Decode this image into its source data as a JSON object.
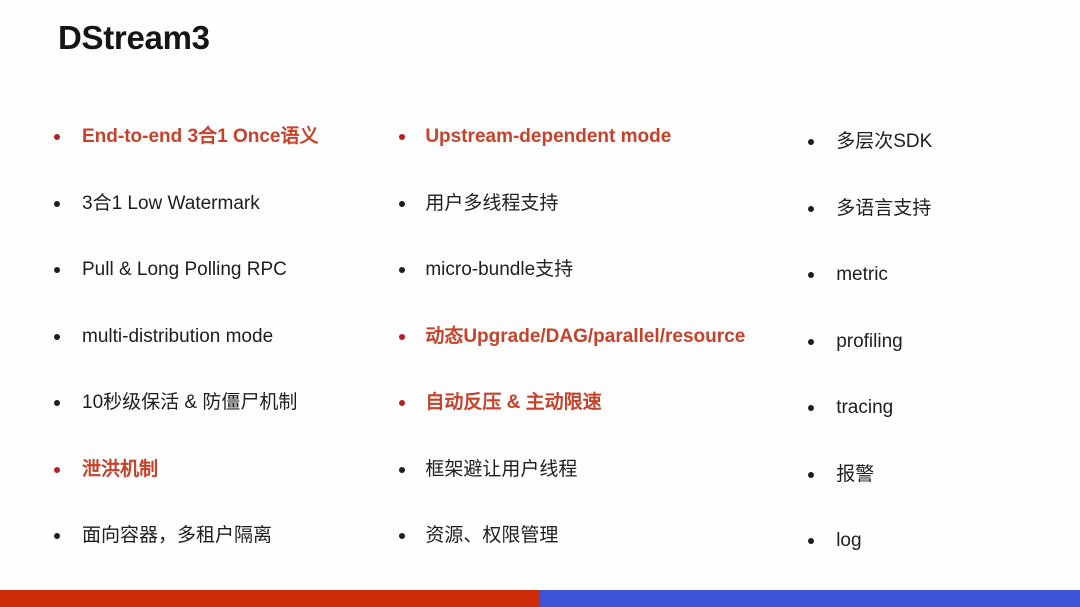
{
  "slide": {
    "title": "DStream3",
    "background_color": "#FEFEFE",
    "accent_color": "#C8412A",
    "text_color": "#1E1E1E",
    "bullet_color": "#1E1E1E",
    "accent_bullet_color": "#B62020"
  },
  "columns": [
    {
      "id": "column-1",
      "items": [
        {
          "label": "End-to-end 3合1 Once语义",
          "accent": true
        },
        {
          "label": "3合1 Low Watermark",
          "accent": false
        },
        {
          "label": "Pull & Long Polling RPC",
          "accent": false
        },
        {
          "label": "multi-distribution mode",
          "accent": false
        },
        {
          "label": "10秒级保活 & 防僵尸机制",
          "accent": false
        },
        {
          "label": "泄洪机制",
          "accent": true
        },
        {
          "label": "面向容器，多租户隔离",
          "accent": false
        }
      ]
    },
    {
      "id": "column-2",
      "items": [
        {
          "label": "Upstream-dependent mode",
          "accent": true
        },
        {
          "label": "用户多线程支持",
          "accent": false
        },
        {
          "label": "micro-bundle支持",
          "accent": false
        },
        {
          "label": "动态Upgrade/DAG/parallel/resource",
          "accent": true
        },
        {
          "label": "自动反压 & 主动限速",
          "accent": true
        },
        {
          "label": "框架避让用户线程",
          "accent": false
        },
        {
          "label": "资源、权限管理",
          "accent": false
        }
      ]
    },
    {
      "id": "column-3",
      "items": [
        {
          "label": "多层次SDK",
          "accent": false
        },
        {
          "label": "多语言支持",
          "accent": false
        },
        {
          "label": "metric",
          "accent": false
        },
        {
          "label": "profiling",
          "accent": false
        },
        {
          "label": "tracing",
          "accent": false
        },
        {
          "label": "报警",
          "accent": false
        },
        {
          "label": "log",
          "accent": false
        }
      ]
    }
  ],
  "bottom_bar": {
    "left_color": "#CC2B07",
    "right_color": "#3D53D8"
  }
}
